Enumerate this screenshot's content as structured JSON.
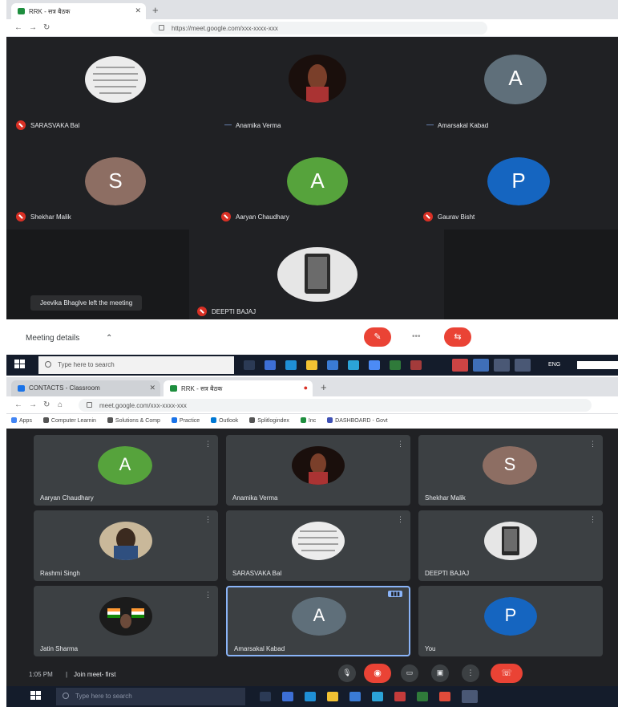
{
  "top": {
    "tab": {
      "label": "RRK - सत्र बैठक"
    },
    "address": {
      "url": "https://meet.google.com/xxx-xxxx-xxx"
    },
    "participants": [
      {
        "name": "SARASVAKA Bal",
        "initial": "",
        "avatar_type": "photo",
        "color": "#d9d9d9"
      },
      {
        "name": "Anamika Verma",
        "initial": "",
        "avatar_type": "photo",
        "color": "#5a2a1a"
      },
      {
        "name": "Amarsakal Kabad",
        "initial": "A",
        "avatar_type": "letter",
        "color": "#5f6f7a"
      },
      {
        "name": "Shekhar Malik",
        "initial": "S",
        "avatar_type": "letter",
        "color": "#8d6e63"
      },
      {
        "name": "Aaryan Chaudhary",
        "initial": "A",
        "avatar_type": "letter",
        "color": "#56a33c"
      },
      {
        "name": "Gaurav Bisht",
        "initial": "P",
        "avatar_type": "letter",
        "color": "#1565c0"
      },
      {
        "name": "DEEPTI BAJAJ",
        "initial": "",
        "avatar_type": "photo",
        "color": "#e0e0e0"
      }
    ],
    "toast": "Jeevika Bhaglve left the meeting",
    "meeting_details": "Meeting details",
    "chevron": "⌃",
    "controls": {
      "mic": "✎",
      "dots": "•••",
      "cam": "⇆"
    },
    "taskbar": {
      "search": "Type here to search",
      "tray": "ENG"
    }
  },
  "bottom": {
    "tabs": [
      {
        "label": "CONTACTS - Classroom"
      },
      {
        "label": "RRK - सत्र बैठक"
      }
    ],
    "address": {
      "url": "meet.google.com/xxx-xxxx-xxx"
    },
    "bookmarks": [
      "Apps",
      "Computer Learnin",
      "Solutions & Comp",
      "Practice",
      "Outlook",
      "Splitlogindex",
      "Inc",
      "DASHBOARD - Govt"
    ],
    "participants": [
      {
        "name": "Aaryan Chaudhary",
        "initial": "A",
        "avatar_type": "letter",
        "color": "#56a33c"
      },
      {
        "name": "Anamika Verma",
        "initial": "",
        "avatar_type": "photo",
        "color": "#5a2a1a"
      },
      {
        "name": "Shekhar Malik",
        "initial": "S",
        "avatar_type": "letter",
        "color": "#8d6e63"
      },
      {
        "name": "Rashmi Singh",
        "initial": "",
        "avatar_type": "photo",
        "color": "#3a5a7a"
      },
      {
        "name": "SARASVAKA Bal",
        "initial": "",
        "avatar_type": "photo",
        "color": "#d9d9d9"
      },
      {
        "name": "DEEPTI BAJAJ",
        "initial": "",
        "avatar_type": "photo",
        "color": "#e0e0e0"
      },
      {
        "name": "Jatin Sharma",
        "initial": "",
        "avatar_type": "photo",
        "color": "#3a3a3a"
      },
      {
        "name": "Amarsakal Kabad",
        "initial": "A",
        "avatar_type": "letter",
        "color": "#5f6f7a"
      },
      {
        "name": "You",
        "initial": "P",
        "avatar_type": "letter",
        "color": "#1565c0"
      }
    ],
    "meeting_code": "Join meet- first",
    "time": "1:05 PM",
    "controls": {
      "mic": "🎙",
      "cam": "◉",
      "cc": "▭",
      "present": "▣",
      "more": "⋮",
      "end": "☏"
    },
    "taskbar": {
      "search": "Type here to search"
    }
  }
}
